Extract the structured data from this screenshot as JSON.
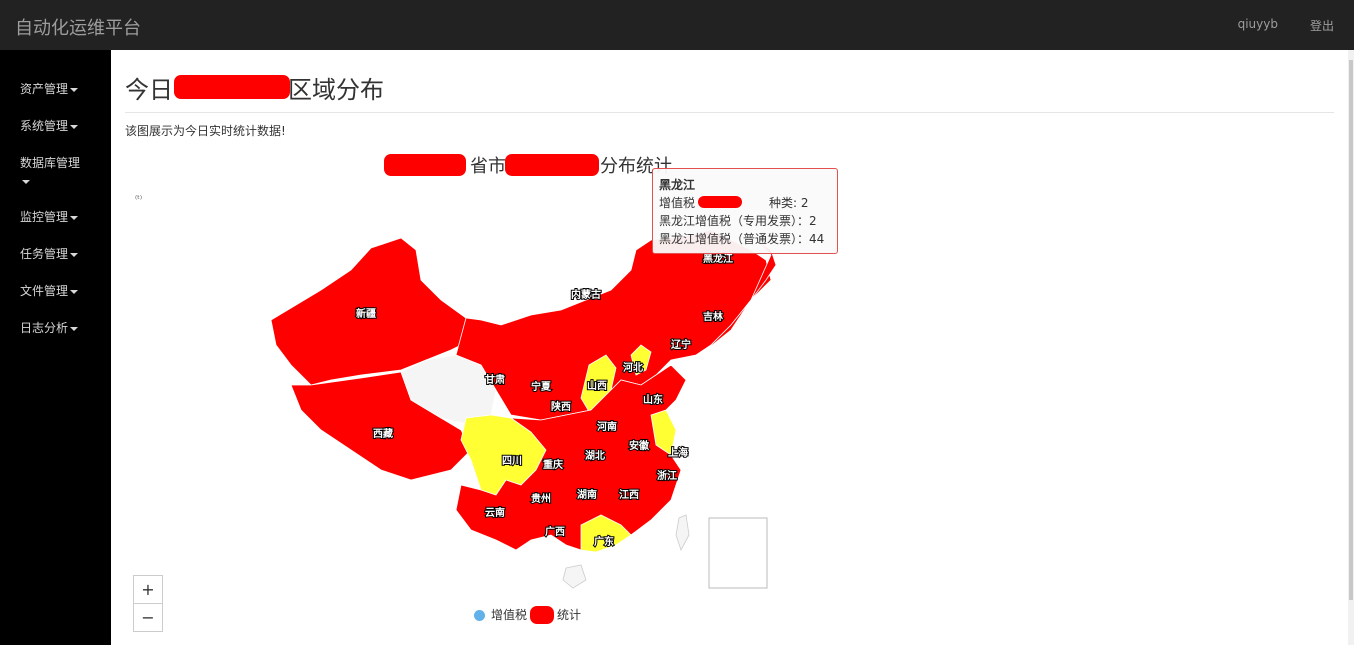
{
  "header": {
    "app_title": "自动化运维平台",
    "user": "qiuyyb",
    "logout": "登出"
  },
  "sidebar": {
    "items": [
      {
        "label": "资产管理"
      },
      {
        "label": "系统管理"
      },
      {
        "label": "数据库管理"
      },
      {
        "label": "监控管理"
      },
      {
        "label": "任务管理"
      },
      {
        "label": "文件管理"
      },
      {
        "label": "日志分析"
      }
    ]
  },
  "main": {
    "title_prefix": "今日",
    "title_suffix": "区域分布",
    "description": "该图展示为今日实时统计数据!",
    "chart_title_mid": "省市",
    "chart_title_suffix": "分布统计",
    "legend_label_prefix": "增值税",
    "legend_label_suffix": "统计",
    "zoom_in": "+",
    "zoom_out": "−"
  },
  "tooltip": {
    "title": "黑龙江",
    "line1_prefix": "增值税",
    "line1_suffix": "种类: 2",
    "line2": "黑龙江增值税（专用发票）：2",
    "line3": "黑龙江增值税（普通发票）：44"
  },
  "map_labels": [
    "新疆",
    "西藏",
    "内蒙古",
    "黑龙江",
    "吉林",
    "辽宁",
    "河北",
    "山西",
    "山东",
    "甘肃",
    "宁夏",
    "陕西",
    "河南",
    "安徽",
    "上海",
    "四川",
    "重庆",
    "湖北",
    "浙江",
    "贵州",
    "湖南",
    "江西",
    "云南",
    "广西",
    "广东"
  ],
  "colors": {
    "high": "#ff0000",
    "low": "#ffff33",
    "none": "#f5f5f5",
    "legend": "#61b1ea"
  }
}
